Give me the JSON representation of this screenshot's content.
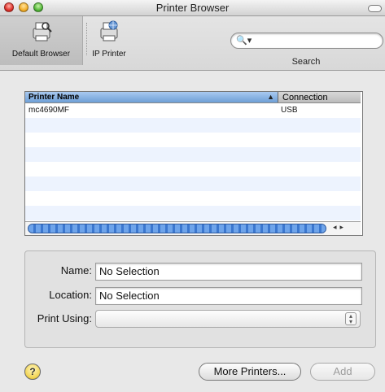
{
  "window": {
    "title": "Printer Browser"
  },
  "toolbar": {
    "default_browser_label": "Default Browser",
    "ip_printer_label": "IP Printer",
    "search_label": "Search",
    "search_placeholder": ""
  },
  "table": {
    "columns": [
      "Printer Name",
      "Connection"
    ],
    "sort_indicator": "▲",
    "rows": [
      {
        "name": "mc4690MF",
        "connection": "USB"
      }
    ]
  },
  "form": {
    "name_label": "Name:",
    "name_value": "No Selection",
    "location_label": "Location:",
    "location_value": "No Selection",
    "print_using_label": "Print Using:",
    "print_using_value": ""
  },
  "footer": {
    "help_label": "?",
    "more_printers_label": "More Printers...",
    "add_label": "Add"
  },
  "colors": {
    "header_selected": "#6e9fd6",
    "row_stripe": "#edf3fe",
    "scroll_thumb": "#3b77cf"
  }
}
